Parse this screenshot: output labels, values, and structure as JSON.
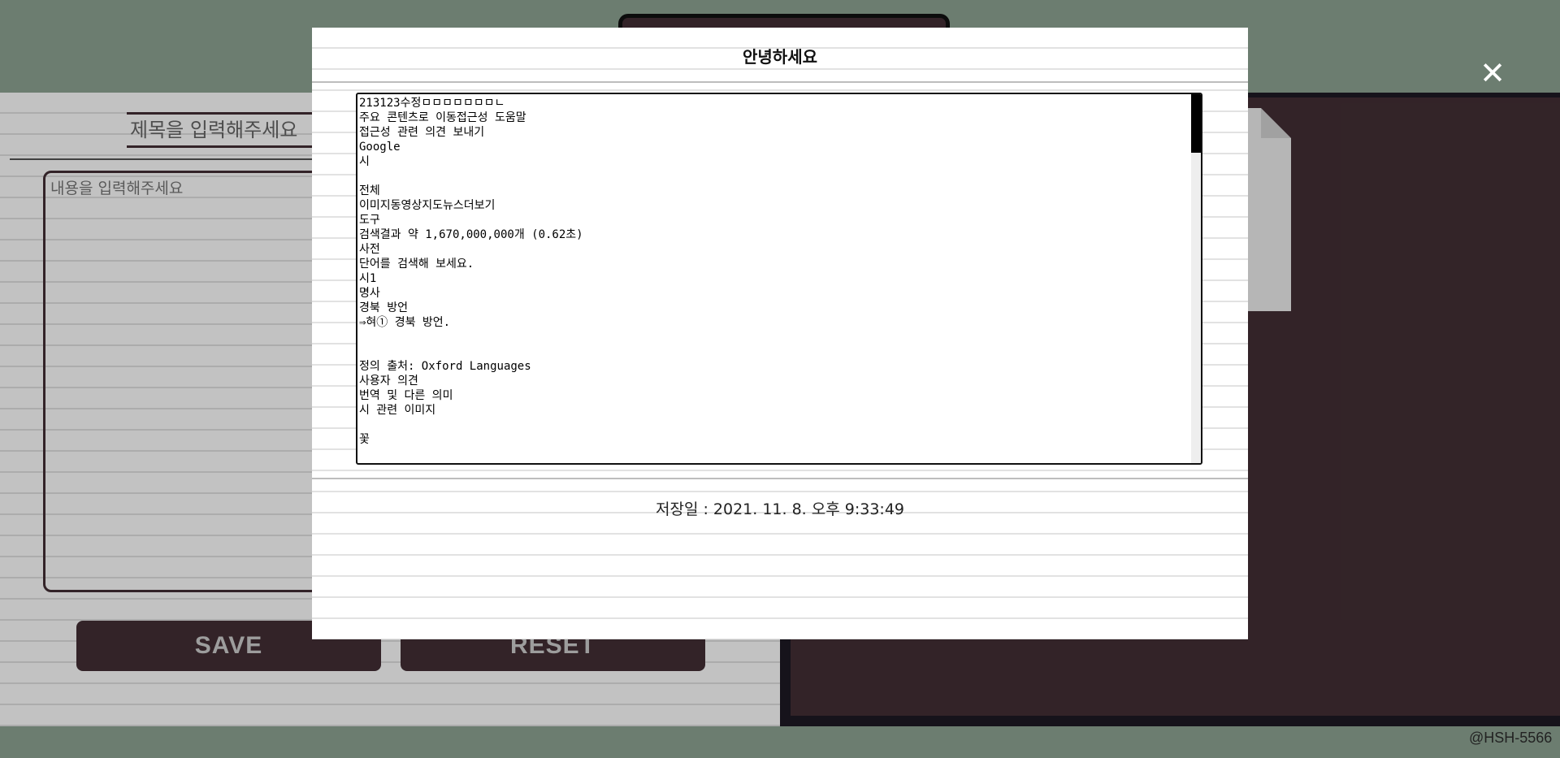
{
  "editor": {
    "title_placeholder": "제목을 입력해주세요",
    "content_placeholder": "내용을 입력해주세요",
    "save_label": "SAVE",
    "reset_label": "RESET"
  },
  "modal": {
    "title": "안녕하세요",
    "body": "213123수정ㅁㅁㅁㅁㅁㅁㅁㄴ\n주요 콘텐츠로 이동접근성 도움말\n접근성 관련 의견 보내기\nGoogle\n시\n\n전체\n이미지동영상지도뉴스더보기\n도구\n검색결과 약 1,670,000,000개 (0.62초)\n사전\n단어를 검색해 보세요.\n시1\n명사\n경북 방언\n⇒혀① 경북 방언.\n\n\n정의 출처: Oxford Languages\n사용자 의견\n번역 및 다른 의미\n시 관련 이미지\n\n꽃",
    "saved_date": "저장일 : 2021. 11. 8. 오후 9:33:49"
  },
  "close_icon": "close-icon",
  "credit": "@HSH-5566",
  "colors": {
    "background": "#8fa594",
    "accent": "#432f35",
    "dark_frame": "#1e1a24"
  }
}
